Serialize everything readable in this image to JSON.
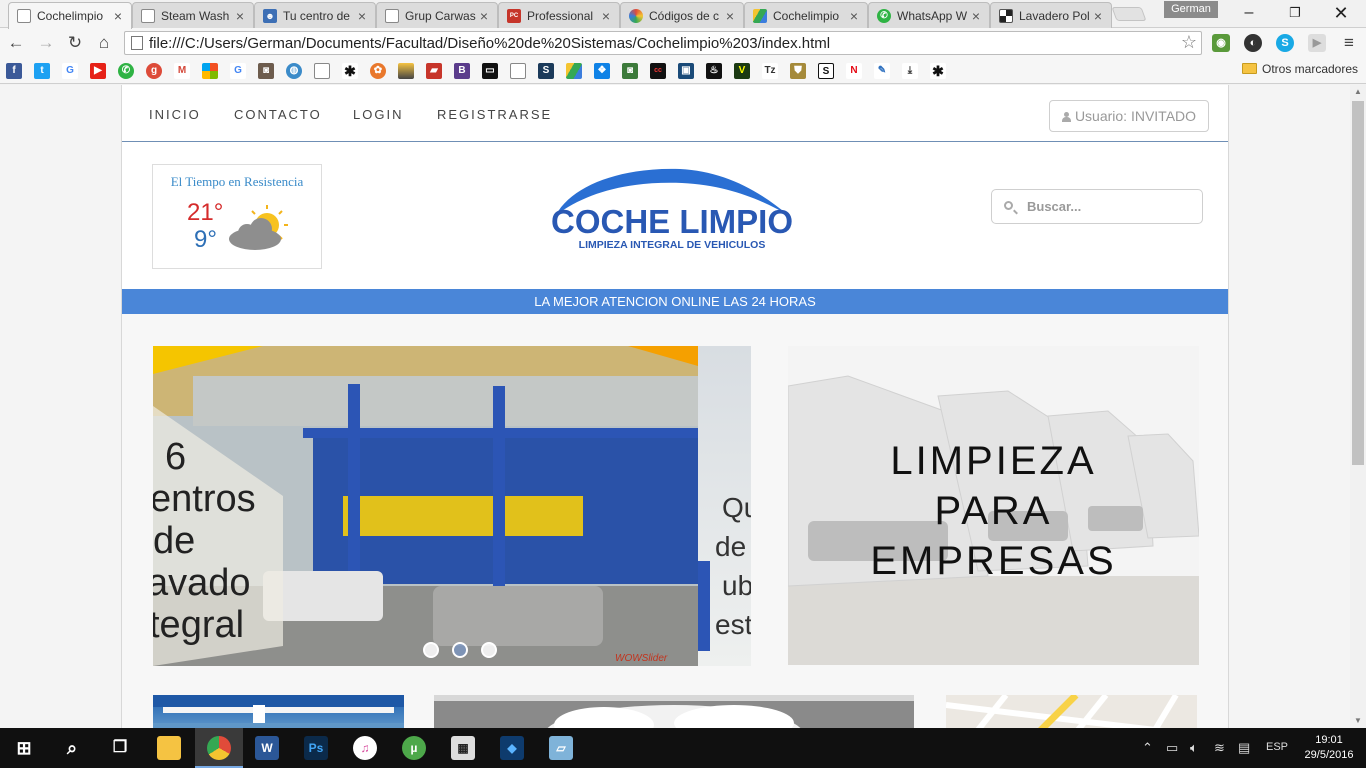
{
  "browser": {
    "tabs": [
      {
        "title": "Cochelimpio",
        "icon": "page-icon",
        "color": "#ffffff"
      },
      {
        "title": "Steam Wash",
        "icon": "page-icon",
        "color": "#ffffff"
      },
      {
        "title": "Tu centro de",
        "icon": "person-icon",
        "color": "#3d6fb5"
      },
      {
        "title": "Grup Carwas",
        "icon": "page-icon",
        "color": "#ffffff"
      },
      {
        "title": "Professional",
        "icon": "pcbo-icon",
        "color": "#c6352a"
      },
      {
        "title": "Códigos de c",
        "icon": "color-wheel-icon",
        "color": "#e04b3a"
      },
      {
        "title": "Cochelimpio",
        "icon": "drive-icon",
        "color": "#2f9c4f"
      },
      {
        "title": "WhatsApp W",
        "icon": "whatsapp-icon",
        "color": "#2fb344"
      },
      {
        "title": "Lavadero Pol",
        "icon": "checker-icon",
        "color": "#444444"
      }
    ],
    "profile_name": "German",
    "url": "file:///C:/Users/German/Documents/Facultad/Diseño%20de%20Sistemas/Cochelimpio%203/index.html",
    "other_bookmarks": "Otros marcadores"
  },
  "site": {
    "nav": {
      "inicio": "INICIO",
      "contacto": "CONTACTO",
      "login": "LOGIN",
      "registrarse": "REGISTRARSE"
    },
    "user_label": "Usuario: INVITADO",
    "weather": {
      "title": "El Tiempo en Resistencia",
      "high": "21°",
      "low": "9°"
    },
    "logo": {
      "name": "COCHE LIMPIO",
      "tagline": "LIMPIEZA INTEGRAL DE VEHICULOS"
    },
    "search_placeholder": "Buscar...",
    "banner": "LA MEJOR ATENCION ONLINE LAS 24 HORAS",
    "slider": {
      "text_left": [
        "6",
        "entros",
        "de",
        "avado",
        "tegral"
      ],
      "text_right": [
        "Qu",
        "de",
        "ub",
        "est"
      ],
      "watermark": "WOWSlider",
      "active_slide": 2,
      "slide_count": 3
    },
    "empresas": [
      "LIMPIEZA",
      "PARA",
      "EMPRESAS"
    ]
  },
  "taskbar": {
    "clock_time": "19:01",
    "clock_date": "29/5/2016",
    "language": "ESP"
  }
}
